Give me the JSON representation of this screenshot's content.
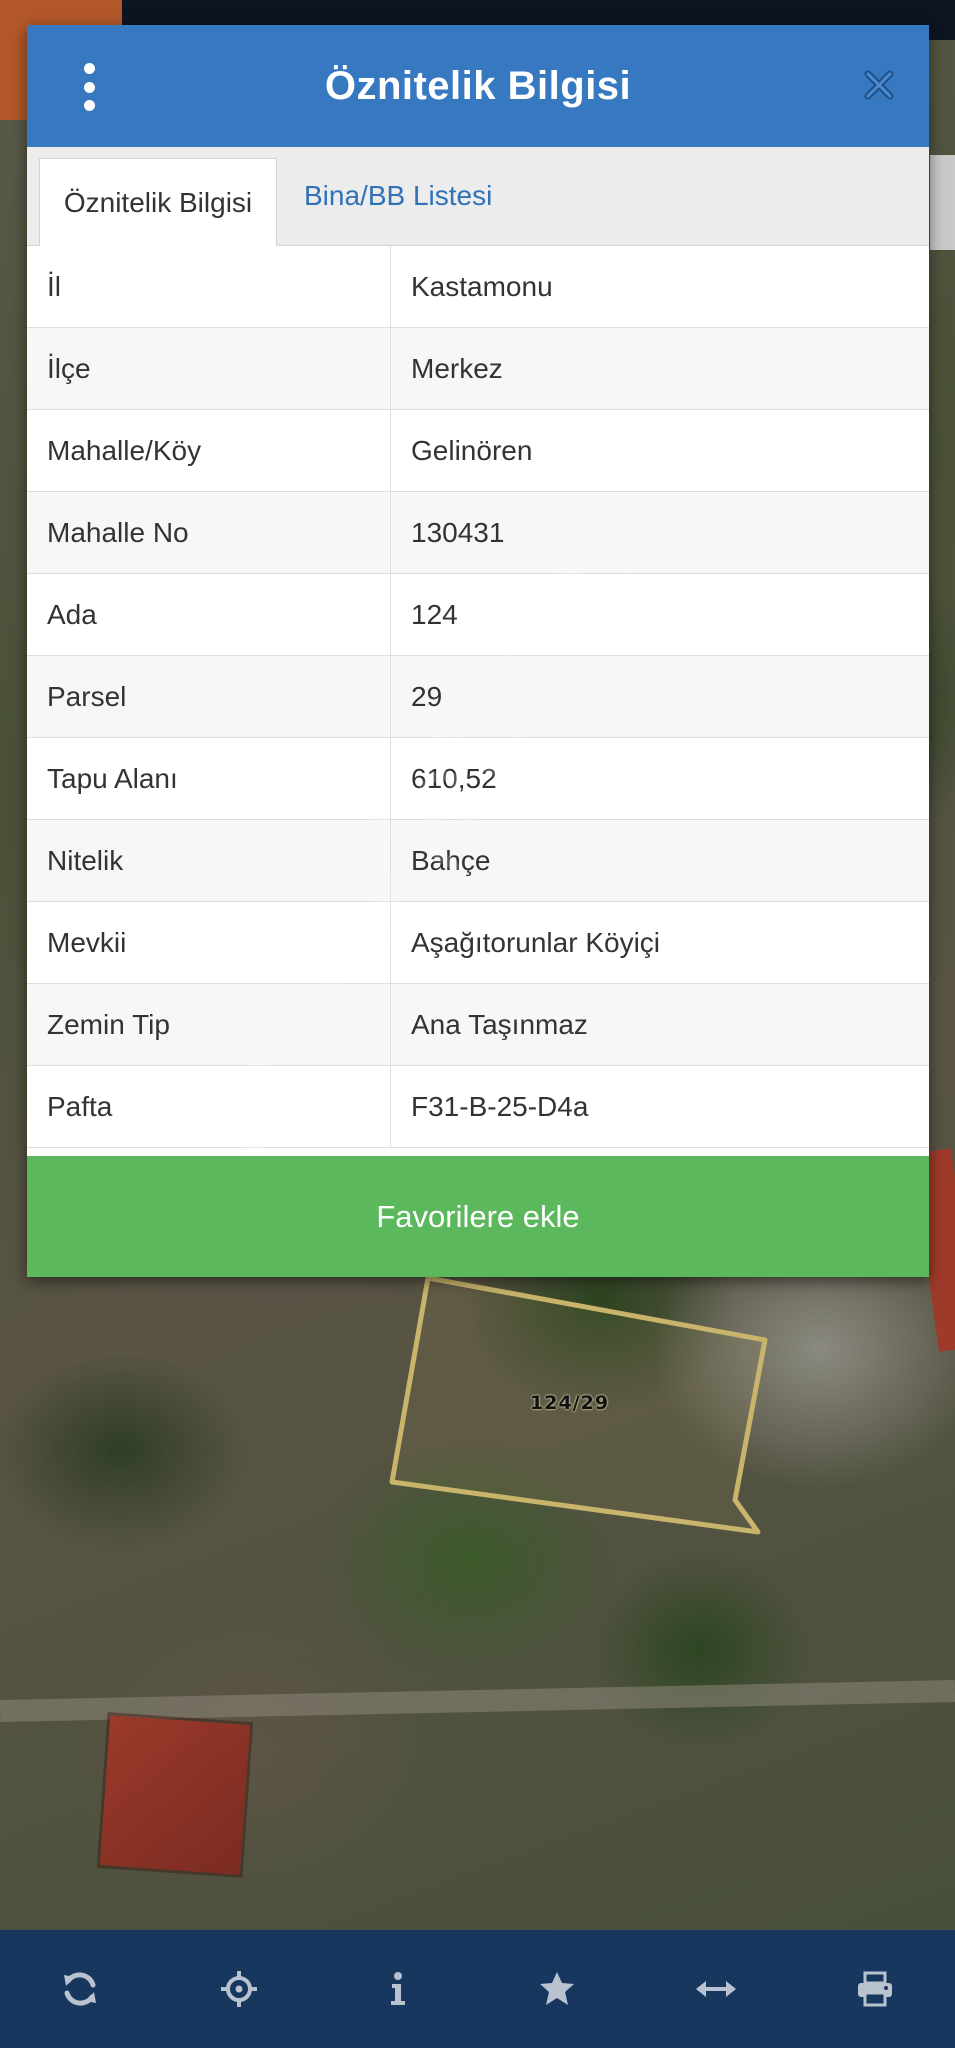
{
  "header": {
    "title": "Öznitelik Bilgisi"
  },
  "tabs": [
    {
      "label": "Öznitelik Bilgisi",
      "active": true
    },
    {
      "label": "Bina/BB Listesi",
      "active": false
    }
  ],
  "attributes": [
    {
      "key": "İl",
      "value": "Kastamonu"
    },
    {
      "key": "İlçe",
      "value": "Merkez"
    },
    {
      "key": "Mahalle/Köy",
      "value": "Gelinören"
    },
    {
      "key": "Mahalle No",
      "value": "130431"
    },
    {
      "key": "Ada",
      "value": "124"
    },
    {
      "key": "Parsel",
      "value": "29"
    },
    {
      "key": "Tapu Alanı",
      "value": "610,52"
    },
    {
      "key": "Nitelik",
      "value": "Bahçe"
    },
    {
      "key": "Mevkii",
      "value": "Aşağıtorunlar Köyiçi"
    },
    {
      "key": "Zemin Tip",
      "value": "Ana Taşınmaz"
    },
    {
      "key": "Pafta",
      "value": "F31-B-25-D4a"
    }
  ],
  "favorite_button": "Favorilere ekle",
  "map": {
    "parcel_label": "124/29",
    "watermark": "emlakjet.com"
  },
  "toolbar_icons": [
    "refresh-icon",
    "crosshair-icon",
    "info-icon",
    "star-icon",
    "measure-icon",
    "print-icon"
  ],
  "colors": {
    "header": "#3779c0",
    "tab_link": "#2f72b8",
    "favorite_button": "#5cb85c",
    "toolbar": "#17375e",
    "parcel_outline": "#c8b46a"
  }
}
